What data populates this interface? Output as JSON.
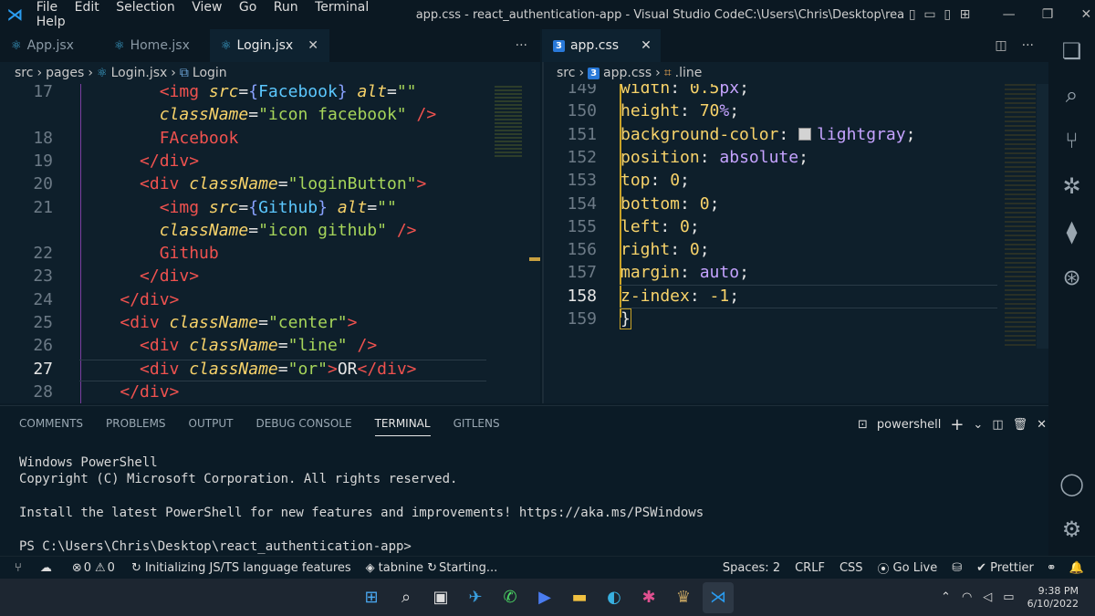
{
  "titlebar": {
    "menus": [
      "File",
      "Edit",
      "Selection",
      "View",
      "Go",
      "Run",
      "Terminal",
      "Help"
    ],
    "title": "app.css - react_authentication-app - Visual Studio CodeC:\\Users\\Chris\\Desktop\\react_authentica..."
  },
  "left_tabs": [
    {
      "label": "App.jsx",
      "icon": "react-icon"
    },
    {
      "label": "Home.jsx",
      "icon": "react-icon"
    },
    {
      "label": "Login.jsx",
      "icon": "react-icon",
      "active": true
    }
  ],
  "right_tabs": [
    {
      "label": "app.css",
      "icon": "css-icon",
      "active": true
    }
  ],
  "left_breadcrumb": [
    "src",
    "pages",
    "Login.jsx",
    "Login"
  ],
  "right_breadcrumb": [
    "src",
    "app.css",
    ".line"
  ],
  "left_lines": [
    {
      "n": "17",
      "parts": [
        [
          "tag",
          "<img "
        ],
        [
          "attr",
          "src"
        ],
        [
          "white",
          "="
        ],
        [
          "brace",
          "{"
        ],
        [
          "var",
          "Facebook"
        ],
        [
          "brace",
          "}"
        ],
        [
          "white",
          " "
        ],
        [
          "attr",
          "alt"
        ],
        [
          "white",
          "="
        ],
        [
          "str",
          "\"\""
        ]
      ],
      "indent": "        "
    },
    {
      "n": "",
      "parts": [
        [
          "attr",
          "className"
        ],
        [
          "white",
          "="
        ],
        [
          "str",
          "\"icon facebook\""
        ],
        [
          "white",
          " "
        ],
        [
          "tag",
          "/>"
        ]
      ],
      "indent": "        "
    },
    {
      "n": "18",
      "parts": [
        [
          "txt",
          "FAcebook"
        ]
      ],
      "indent": "        "
    },
    {
      "n": "19",
      "parts": [
        [
          "tag",
          "</div>"
        ]
      ],
      "indent": "      "
    },
    {
      "n": "20",
      "parts": [
        [
          "tag",
          "<div "
        ],
        [
          "attr",
          "className"
        ],
        [
          "white",
          "="
        ],
        [
          "str",
          "\"loginButton\""
        ],
        [
          "tag",
          ">"
        ]
      ],
      "indent": "      "
    },
    {
      "n": "21",
      "parts": [
        [
          "tag",
          "<img "
        ],
        [
          "attr",
          "src"
        ],
        [
          "white",
          "="
        ],
        [
          "brace",
          "{"
        ],
        [
          "var",
          "Github"
        ],
        [
          "brace",
          "}"
        ],
        [
          "white",
          " "
        ],
        [
          "attr",
          "alt"
        ],
        [
          "white",
          "="
        ],
        [
          "str",
          "\"\""
        ]
      ],
      "indent": "        "
    },
    {
      "n": "",
      "parts": [
        [
          "attr",
          "className"
        ],
        [
          "white",
          "="
        ],
        [
          "str",
          "\"icon github\""
        ],
        [
          "white",
          " "
        ],
        [
          "tag",
          "/>"
        ]
      ],
      "indent": "        "
    },
    {
      "n": "22",
      "parts": [
        [
          "txt",
          "Github"
        ]
      ],
      "indent": "        "
    },
    {
      "n": "23",
      "parts": [
        [
          "tag",
          "</div>"
        ]
      ],
      "indent": "      "
    },
    {
      "n": "24",
      "parts": [
        [
          "tag",
          "</div>"
        ]
      ],
      "indent": "    "
    },
    {
      "n": "25",
      "parts": [
        [
          "tag",
          "<div "
        ],
        [
          "attr",
          "className"
        ],
        [
          "white",
          "="
        ],
        [
          "str",
          "\"center\""
        ],
        [
          "tag",
          ">"
        ]
      ],
      "indent": "    "
    },
    {
      "n": "26",
      "parts": [
        [
          "tag",
          "<div "
        ],
        [
          "attr",
          "className"
        ],
        [
          "white",
          "="
        ],
        [
          "str",
          "\"line\""
        ],
        [
          "white",
          " "
        ],
        [
          "tag",
          "/>"
        ]
      ],
      "indent": "      "
    },
    {
      "n": "27",
      "parts": [
        [
          "tag",
          "<div "
        ],
        [
          "attr",
          "className"
        ],
        [
          "white",
          "="
        ],
        [
          "str",
          "\"or\""
        ],
        [
          "tag",
          ">"
        ],
        [
          "white",
          "OR"
        ],
        [
          "tag",
          "</div>"
        ]
      ],
      "indent": "      ",
      "current": true
    },
    {
      "n": "28",
      "parts": [
        [
          "tag",
          "</div>"
        ]
      ],
      "indent": "    "
    }
  ],
  "right_lines": [
    {
      "n": "149",
      "parts": [
        [
          "prop",
          "width"
        ],
        [
          "white",
          ": "
        ],
        [
          "num",
          "0.5"
        ],
        [
          "val",
          "px"
        ],
        [
          "white",
          ";"
        ]
      ]
    },
    {
      "n": "150",
      "parts": [
        [
          "prop",
          "height"
        ],
        [
          "white",
          ": "
        ],
        [
          "num",
          "70"
        ],
        [
          "val",
          "%"
        ],
        [
          "white",
          ";"
        ]
      ]
    },
    {
      "n": "151",
      "parts": [
        [
          "prop",
          "background-color"
        ],
        [
          "white",
          ": "
        ],
        [
          "swatch",
          ""
        ],
        [
          "val",
          "lightgray"
        ],
        [
          "white",
          ";"
        ]
      ]
    },
    {
      "n": "152",
      "parts": [
        [
          "prop",
          "position"
        ],
        [
          "white",
          ": "
        ],
        [
          "val",
          "absolute"
        ],
        [
          "white",
          ";"
        ]
      ]
    },
    {
      "n": "153",
      "parts": [
        [
          "prop",
          "top"
        ],
        [
          "white",
          ": "
        ],
        [
          "num",
          "0"
        ],
        [
          "white",
          ";"
        ]
      ]
    },
    {
      "n": "154",
      "parts": [
        [
          "prop",
          "bottom"
        ],
        [
          "white",
          ": "
        ],
        [
          "num",
          "0"
        ],
        [
          "white",
          ";"
        ]
      ]
    },
    {
      "n": "155",
      "parts": [
        [
          "prop",
          "left"
        ],
        [
          "white",
          ": "
        ],
        [
          "num",
          "0"
        ],
        [
          "white",
          ";"
        ]
      ]
    },
    {
      "n": "156",
      "parts": [
        [
          "prop",
          "right"
        ],
        [
          "white",
          ": "
        ],
        [
          "num",
          "0"
        ],
        [
          "white",
          ";"
        ]
      ]
    },
    {
      "n": "157",
      "parts": [
        [
          "prop",
          "margin"
        ],
        [
          "white",
          ": "
        ],
        [
          "val",
          "auto"
        ],
        [
          "white",
          ";"
        ]
      ]
    },
    {
      "n": "158",
      "parts": [
        [
          "prop",
          "z-index"
        ],
        [
          "white",
          ": "
        ],
        [
          "num",
          "-1"
        ],
        [
          "white",
          ";"
        ]
      ],
      "current": true
    },
    {
      "n": "159",
      "parts": [
        [
          "white",
          "}"
        ]
      ],
      "closing": true
    }
  ],
  "panel": {
    "tabs": [
      "COMMENTS",
      "PROBLEMS",
      "OUTPUT",
      "DEBUG CONSOLE",
      "TERMINAL",
      "GITLENS"
    ],
    "active_tab": "TERMINAL",
    "shell": "powershell",
    "terminal_lines": [
      "Windows PowerShell",
      "Copyright (C) Microsoft Corporation. All rights reserved.",
      "",
      "Install the latest PowerShell for new features and improvements! https://aka.ms/PSWindows",
      "",
      "PS C:\\Users\\Chris\\Desktop\\react_authentication-app>"
    ]
  },
  "status": {
    "errors": "0",
    "warnings": "0",
    "js_ts": "Initializing JS/TS language features",
    "tabnine": "tabnine",
    "starting": "Starting...",
    "spaces": "Spaces: 2",
    "eol": "CRLF",
    "lang": "CSS",
    "golive": "Go Live",
    "prettier": "Prettier"
  },
  "taskbar": {
    "time": "9:38 PM",
    "date": "6/10/2022"
  },
  "colors": {
    "accent": "#2a9cf0",
    "editor_bg": "#0e1f2b",
    "panel_bg": "#0b1b26"
  }
}
